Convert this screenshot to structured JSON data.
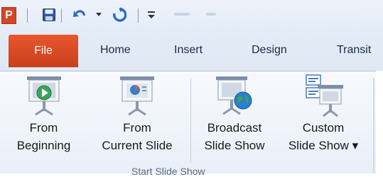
{
  "quick_access": {
    "app_icon_letter": "P"
  },
  "tabs": [
    {
      "label": "File"
    },
    {
      "label": "Home"
    },
    {
      "label": "Insert"
    },
    {
      "label": "Design"
    },
    {
      "label": "Transit"
    }
  ],
  "ribbon": {
    "commands": [
      {
        "line1": "From",
        "line2": "Beginning"
      },
      {
        "line1": "From",
        "line2": "Current Slide"
      },
      {
        "line1": "Broadcast",
        "line2": "Slide Show"
      },
      {
        "line1": "Custom",
        "line2": "Slide Show ▾"
      }
    ],
    "group_label": "Start Slide Show"
  },
  "colors": {
    "file_tab": "#d24726",
    "app_icon": "#d24726",
    "tab_text": "#1b2a44"
  }
}
